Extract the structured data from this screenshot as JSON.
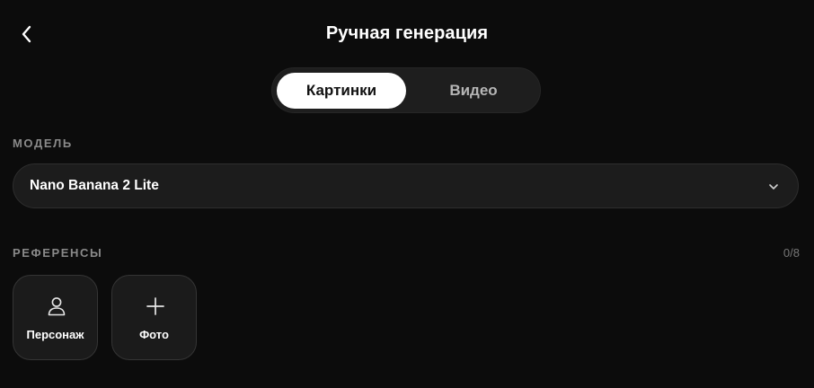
{
  "header": {
    "title": "Ручная генерация",
    "back_icon": "chevron-left-icon"
  },
  "mode_tabs": [
    {
      "label": "Картинки",
      "active": true
    },
    {
      "label": "Видео",
      "active": false
    }
  ],
  "model": {
    "section_label": "МОДЕЛЬ",
    "selected": "Nano Banana 2 Lite",
    "dropdown_icon": "chevron-down-icon"
  },
  "references": {
    "section_label": "РЕФЕРЕНСЫ",
    "count": "0/8",
    "items": [
      {
        "label": "Персонаж",
        "icon": "person-icon"
      },
      {
        "label": "Фото",
        "icon": "plus-icon"
      }
    ]
  },
  "colors": {
    "background": "#0c0c0c",
    "active_tab_bg": "#ffffff",
    "muted_text": "#8a8a8a"
  }
}
